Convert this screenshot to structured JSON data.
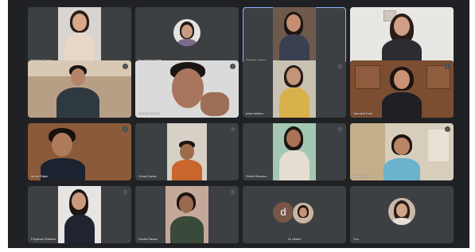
{
  "meeting": {
    "tiles": [
      {
        "id": "purvanshi",
        "name": "Parvana Dagar",
        "muted": true
      },
      {
        "id": "garima",
        "name": "Dr. Garika Singh",
        "muted": false
      },
      {
        "id": "shweta",
        "name": "Shweta Yadav",
        "muted": true
      },
      {
        "id": "host-woman",
        "name": "",
        "muted": false
      },
      {
        "id": "young-man-room",
        "name": "",
        "muted": true
      },
      {
        "id": "closeup",
        "name": "Avinash Kumar",
        "muted": true
      },
      {
        "id": "priya",
        "name": "priya mishra",
        "muted": true
      },
      {
        "id": "teacher",
        "name": "Jasmine Kaur",
        "muted": true
      },
      {
        "id": "mohit",
        "name": "Mohit Rajan",
        "muted": true
      },
      {
        "id": "vinay",
        "name": "Vinay Kumar",
        "muted": true
      },
      {
        "id": "shruti",
        "name": "Shruti Sharma",
        "muted": true
      },
      {
        "id": "naina",
        "name": "Naina Verma",
        "muted": true
      },
      {
        "id": "priyanshi",
        "name": "Priyanshi Rathore",
        "muted": true
      },
      {
        "id": "kavita",
        "name": "Kavita Rawat",
        "muted": true
      },
      {
        "id": "others",
        "name": "10 others",
        "muted": false,
        "initial": "d"
      },
      {
        "id": "you",
        "name": "You",
        "muted": false
      }
    ]
  },
  "icons": {
    "muted_mic": "⋮"
  },
  "colors": {
    "background": "#202124",
    "tile": "#3c4043",
    "speaking_outline": "#8ab4f8",
    "avatar_initial_bg": "#795548"
  }
}
